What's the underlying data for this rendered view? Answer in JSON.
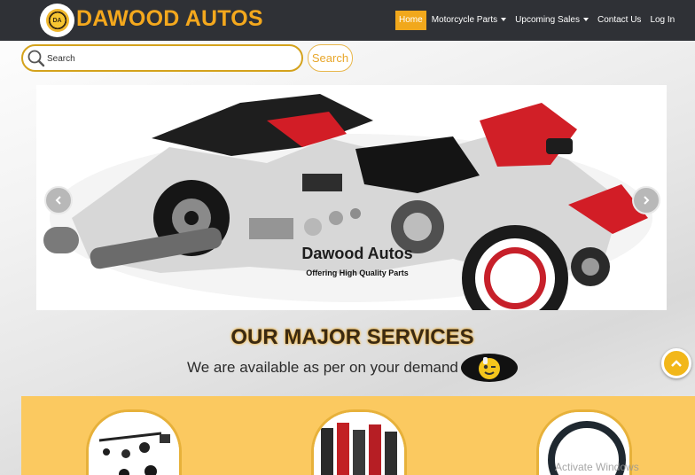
{
  "header": {
    "brand": "DAWOOD AUTOS",
    "logo_text": "DA",
    "nav": [
      {
        "label": "Home",
        "active": true
      },
      {
        "label": "Motorcycle Parts",
        "dropdown": true
      },
      {
        "label": "Upcoming Sales",
        "dropdown": true
      },
      {
        "label": "Contact Us"
      },
      {
        "label": "Log In"
      }
    ]
  },
  "search": {
    "placeholder": "Search",
    "button_label": "Search"
  },
  "carousel": {
    "title": "Dawood Autos",
    "subtitle": "Offering High Quality Parts"
  },
  "services": {
    "title": "OUR MAJOR SERVICES",
    "subtitle": "We are available as per on your demand"
  },
  "watermark": "Activate Windows",
  "colors": {
    "accent": "#f4a81d",
    "nav_bg": "#2f3136",
    "band": "#fbc960"
  }
}
